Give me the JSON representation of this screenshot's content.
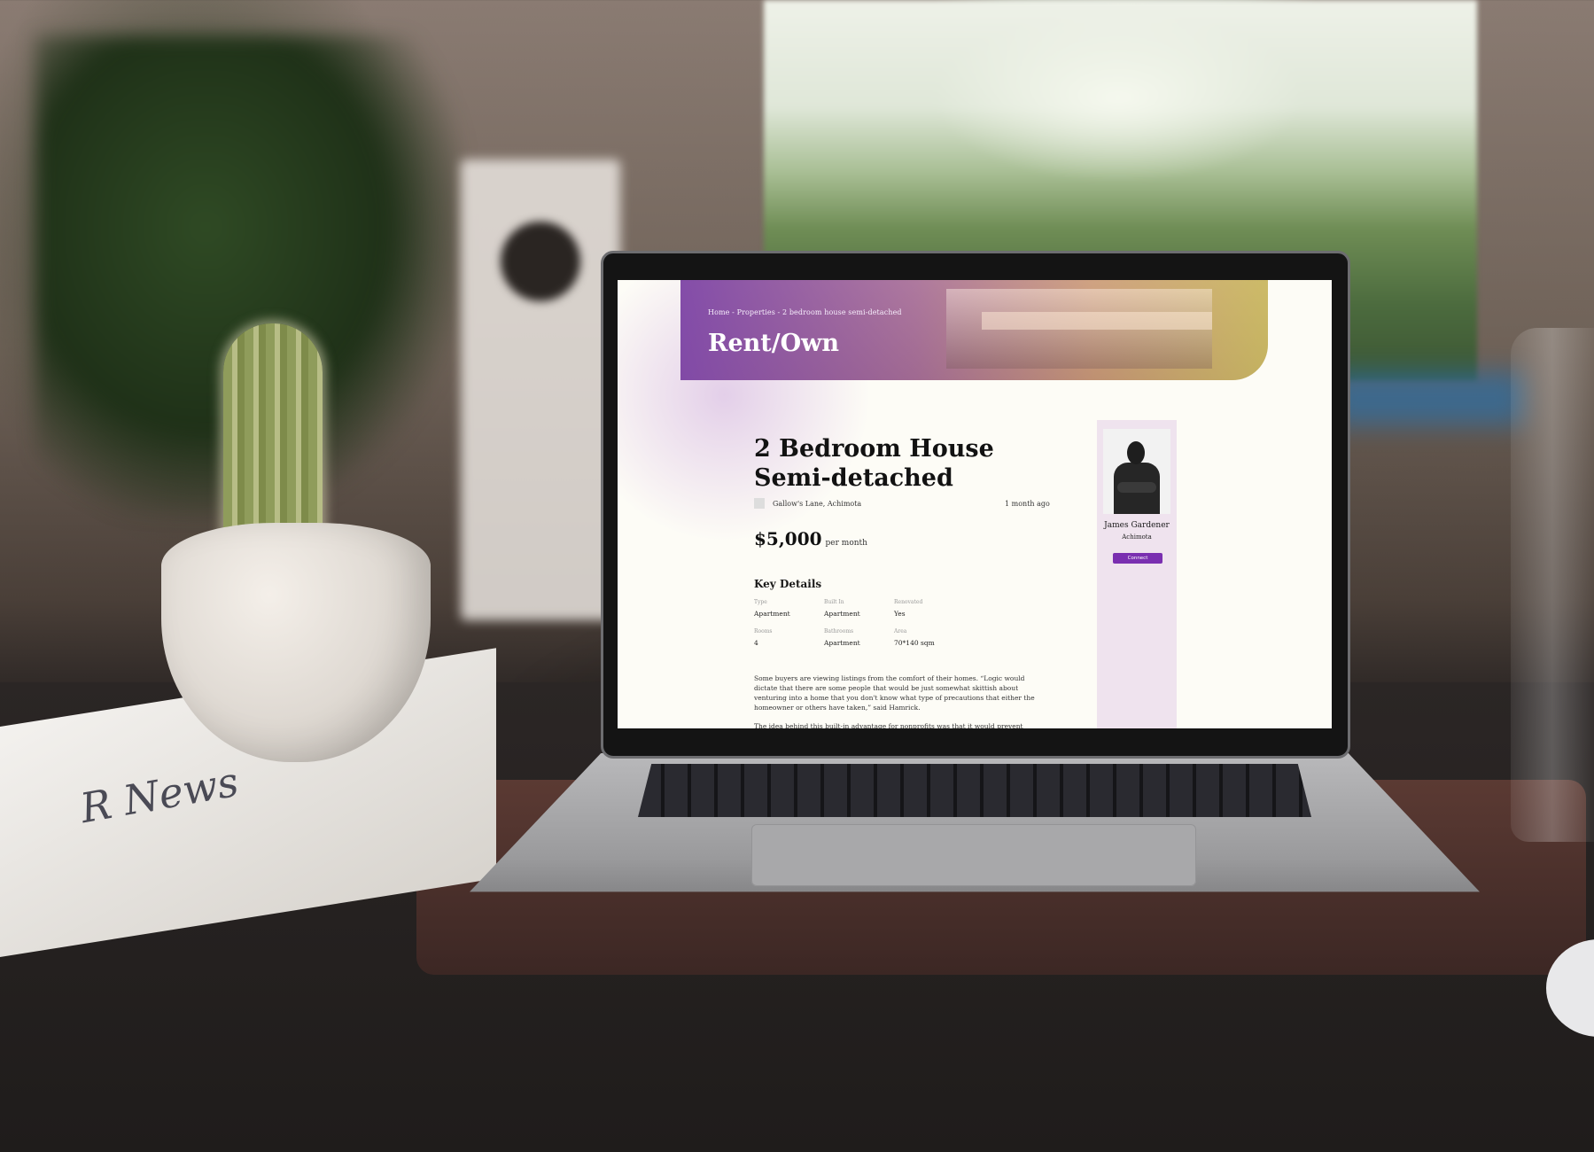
{
  "header": {
    "breadcrumb": "Home - Properties - 2 bedroom house semi-detached",
    "title": "Rent/Own"
  },
  "listing": {
    "title_line1": "2 Bedroom House",
    "title_line2": "Semi-detached",
    "location": "Gallow's Lane, Achimota",
    "posted": "1 month ago",
    "price": "$5,000",
    "price_unit": "per month",
    "key_details_heading": "Key Details",
    "details": [
      {
        "label": "Type",
        "value": "Apartment"
      },
      {
        "label": "Built In",
        "value": "Apartment"
      },
      {
        "label": "Renovated",
        "value": "Yes"
      },
      {
        "label": "Rooms",
        "value": "4"
      },
      {
        "label": "Bathrooms",
        "value": "Apartment"
      },
      {
        "label": "Area",
        "value": "70*140 sqm"
      }
    ],
    "description": [
      "Some buyers are viewing listings from the comfort of their homes. “Logic would dictate that there are some people that would be just somewhat skittish about venturing into a home that you don't know what type of precautions that either the homeowner or others have taken,” said Hamrick.",
      "The idea behind this built-in advantage for nonprofits was that it would prevent rampant speculation, preserve existing affordable housing in gentrifying neighborhoods, and ensure"
    ]
  },
  "agent": {
    "name": "James Gardener",
    "location": "Achimota",
    "connect_label": "Connect"
  },
  "background": {
    "newspaper_title": "R News"
  },
  "colors": {
    "accent": "#7a2fb0",
    "sidebar": "#efe3ee",
    "page": "#fdfcf6"
  }
}
